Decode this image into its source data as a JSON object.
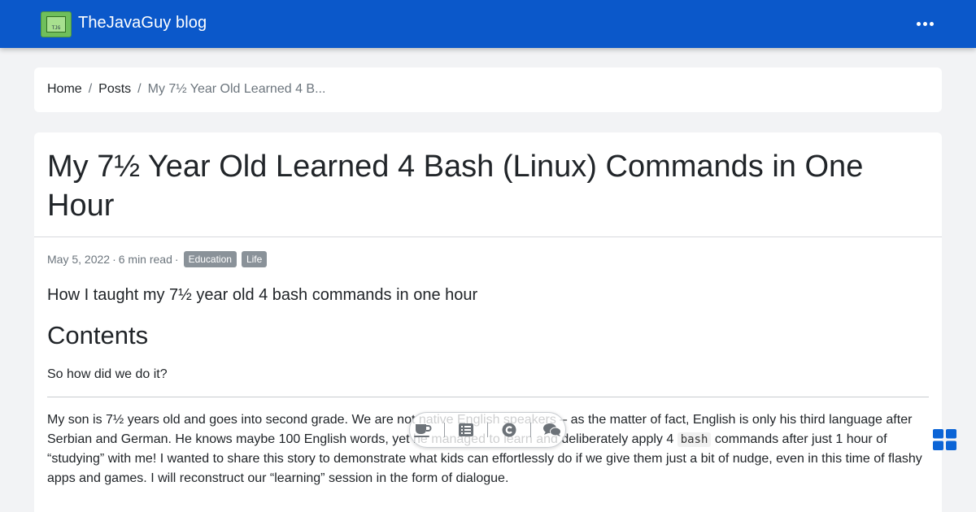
{
  "navbar": {
    "brand": "TheJavaGuy blog",
    "logo_text": "TJG",
    "logo_icon": "computer-screen-logo",
    "more_icon": "ellipsis-horizontal-icon",
    "background_color": "#0b58ca"
  },
  "breadcrumb": {
    "items": [
      "Home",
      "Posts"
    ],
    "separator": "/",
    "current": "My 7½ Year Old Learned 4 B..."
  },
  "post": {
    "title": "My 7½ Year Old Learned 4 Bash (Linux) Commands in One Hour",
    "date": "May 5, 2022",
    "meta_separator": "·",
    "read_time": "6 min read",
    "tags": [
      "Education",
      "Life"
    ],
    "subtitle": "How I taught my 7½ year old 4 bash commands in one hour",
    "contents_heading": "Contents",
    "toc_item": "So how did we do it?",
    "paragraph": {
      "before_code": "My son is 7½ years old and goes into second grade. We are not native English speakers – as the matter of fact, English is only his third language after Serbian and German. He knows maybe 100 English words, yet he managed to learn and deliberately apply 4 ",
      "code": "bash",
      "after_code": " commands after just 1 hour of “studying” with me! I wanted to share this story to demonstrate what kids can effortlessly do if we give them just a bit of nudge, even in this time of flashy apps and games. I will reconstruct our “learning” session in the form of dialogue."
    }
  },
  "floating_toolbar": {
    "icons": [
      "coffee-cup-icon",
      "list-icon",
      "copyright-icon",
      "comments-icon"
    ]
  },
  "corner_widget": {
    "icon": "windows-grid-icon",
    "color": "#0b64d6"
  }
}
